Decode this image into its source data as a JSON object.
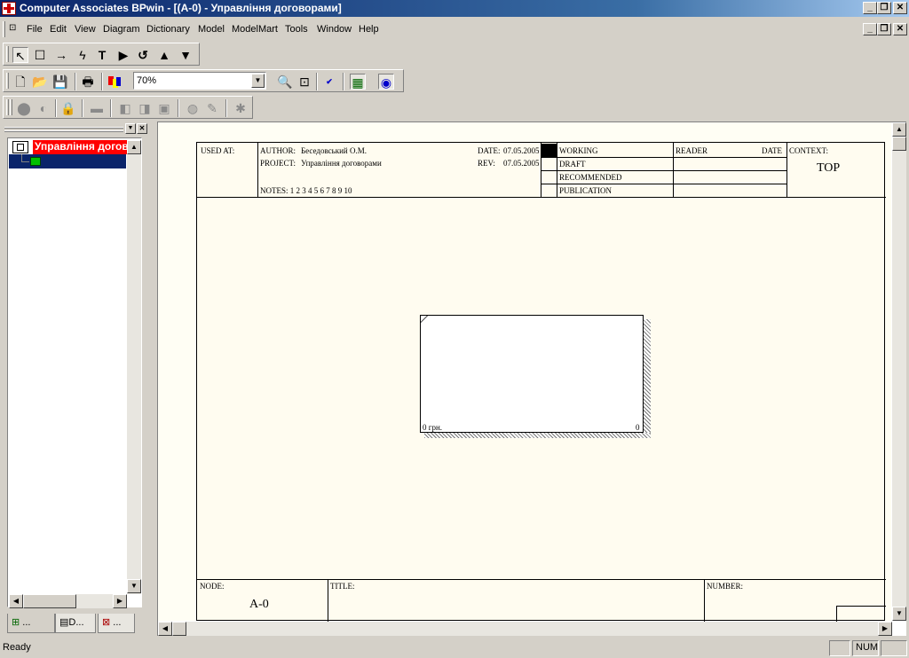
{
  "window": {
    "title": "Computer Associates BPwin - [(A-0)  - Управління договорами]",
    "buttons": [
      "_",
      "❐",
      "✕"
    ]
  },
  "menu": {
    "items": [
      "File",
      "Edit",
      "View",
      "Diagram",
      "Dictionary",
      "Model",
      "ModelMart",
      "Tools",
      "Window",
      "Help"
    ]
  },
  "toolbar": {
    "zoom_value": "70%"
  },
  "tree": {
    "root_label": "Управління договорами",
    "tabs": [
      "...",
      "D...",
      "..."
    ]
  },
  "idef0": {
    "used_at": "USED AT:",
    "author_label": "AUTHOR:",
    "author": "Беседовський О.М.",
    "project_label": "PROJECT:",
    "project": "Управління договорами",
    "notes": "NOTES:  1  2  3  4  5  6  7  8  9  10",
    "date_label": "DATE:",
    "date": "07.05.2005",
    "rev_label": "REV:",
    "rev": "07.05.2005",
    "statuses": [
      "WORKING",
      "DRAFT",
      "RECOMMENDED",
      "PUBLICATION"
    ],
    "reader": "READER",
    "reader_date": "DATE",
    "context_label": "CONTEXT:",
    "context_value": "TOP",
    "node_label": "NODE:",
    "node_value": "A-0",
    "title_label": "TITLE:",
    "number_label": "NUMBER:"
  },
  "activity": {
    "cost": "0 грн.",
    "number": "0"
  },
  "status": {
    "text": "Ready",
    "num": "NUM"
  }
}
